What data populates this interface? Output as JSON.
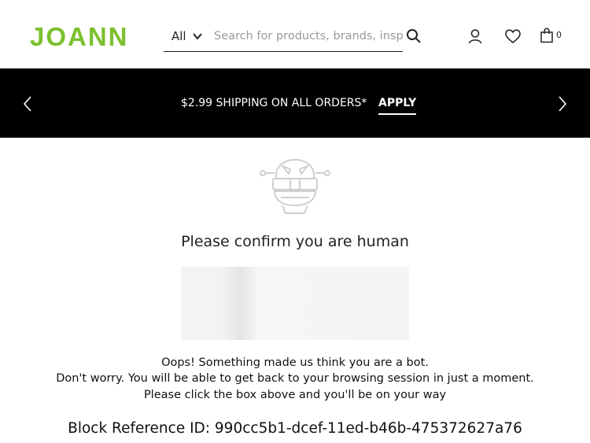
{
  "header": {
    "logo": "JOANN",
    "search": {
      "department": "All",
      "placeholder": "Search for products, brands, inspira",
      "value": ""
    },
    "cart_count": "0"
  },
  "banner": {
    "text": "$2.99 SHIPPING ON ALL ORDERS*",
    "link": "APPLY"
  },
  "main": {
    "title": "Please confirm you are human",
    "message_lines": [
      "Oops! Something made us think you are a bot.",
      "Don't worry. You will be able to get back to your browsing session in just a moment.",
      "Please click the box above and you'll be on your way"
    ],
    "block_reference": "Block Reference ID: 990cc5b1-dcef-11ed-b46b-475372627a76"
  },
  "colors": {
    "brand_green": "#7cc02f",
    "banner_bg": "#000000",
    "robot_stroke": "#cfcfcf"
  },
  "icons": [
    "chevron-down-icon",
    "search-icon",
    "account-icon",
    "heart-icon",
    "shopping-bag-icon",
    "chevron-left-icon",
    "chevron-right-icon",
    "robot-icon"
  ]
}
